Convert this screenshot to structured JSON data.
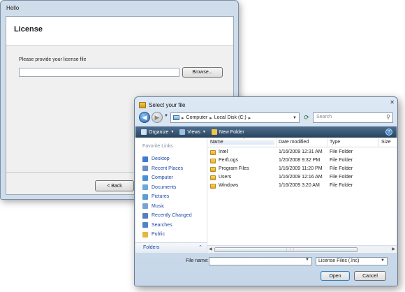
{
  "wizard": {
    "title": "Hello",
    "heading": "License",
    "prompt": "Please provide your license file",
    "license_path_value": "",
    "browse_label": "Browse...",
    "back_label": "< Back"
  },
  "file_dialog": {
    "title": "Select your file",
    "address": {
      "crumbs": [
        "Computer",
        "Local Disk (C:)"
      ]
    },
    "search_placeholder": "Search",
    "toolbar": {
      "organize": "Organize",
      "views": "Views",
      "new_folder": "New Folder"
    },
    "sidebar": {
      "heading": "Favorite Links",
      "items": [
        {
          "label": "Desktop",
          "icon": "desktop-icon",
          "color": "#3a7bd5"
        },
        {
          "label": "Recent Places",
          "icon": "recent-places-icon",
          "color": "#6a8fc0"
        },
        {
          "label": "Computer",
          "icon": "computer-icon",
          "color": "#4a90d9"
        },
        {
          "label": "Documents",
          "icon": "documents-icon",
          "color": "#6fa7d8"
        },
        {
          "label": "Pictures",
          "icon": "pictures-icon",
          "color": "#5a9fd0"
        },
        {
          "label": "Music",
          "icon": "music-icon",
          "color": "#7aa3cf"
        },
        {
          "label": "Recently Changed",
          "icon": "recently-changed-icon",
          "color": "#5580c0"
        },
        {
          "label": "Searches",
          "icon": "searches-icon",
          "color": "#4d86c6"
        },
        {
          "label": "Public",
          "icon": "public-folder-icon",
          "color": "#e7b63b"
        }
      ],
      "folders_label": "Folders"
    },
    "columns": [
      "Name",
      "Date modified",
      "Type",
      "Size"
    ],
    "files": [
      {
        "name": "Intel",
        "date": "1/16/2009 12:31 AM",
        "type": "File Folder"
      },
      {
        "name": "PerfLogs",
        "date": "1/20/2008 9:32 PM",
        "type": "File Folder"
      },
      {
        "name": "Program Files",
        "date": "1/16/2009 11:20 PM",
        "type": "File Folder"
      },
      {
        "name": "Users",
        "date": "1/16/2009 12:16 AM",
        "type": "File Folder"
      },
      {
        "name": "Windows",
        "date": "1/16/2009 3:20 AM",
        "type": "File Folder"
      }
    ],
    "filename_label": "File name:",
    "filename_value": "",
    "filter_value": "License Files (.lnc)",
    "open_label": "Open",
    "cancel_label": "Cancel"
  }
}
